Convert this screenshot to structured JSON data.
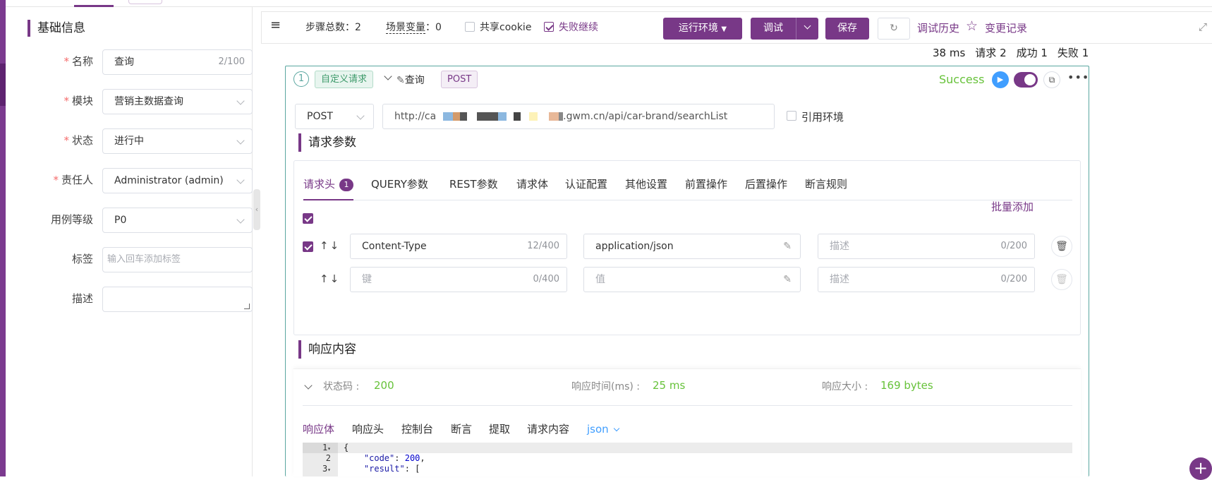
{
  "left_panel": {
    "title": "基础信息",
    "fields": {
      "name": {
        "label": "名称",
        "value": "查询",
        "count": "2/100",
        "required": "*"
      },
      "module": {
        "label": "模块",
        "value": "营销主数据查询",
        "required": "*"
      },
      "status": {
        "label": "状态",
        "value": "进行中",
        "required": "*"
      },
      "owner": {
        "label": "责任人",
        "value": "Administrator (admin)",
        "required": "*"
      },
      "level": {
        "label": "用例等级",
        "value": "P0"
      },
      "tags": {
        "label": "标签",
        "placeholder": "输入回车添加标签"
      },
      "desc": {
        "label": "描述"
      }
    }
  },
  "toolbar": {
    "menu_icon": "≡",
    "step_total_label": "步骤总数：2",
    "scenario_var_label": "场景变量",
    "scenario_var_value": "：0",
    "share_cookie": "共享cookie",
    "fail_continue": "失败继续",
    "run_env": "运行环境",
    "debug": "调试",
    "save": "保存",
    "debug_history": "调试历史",
    "change_log": "变更记录"
  },
  "stats": {
    "time": "38 ms",
    "requests": "请求 2",
    "success": "成功 1",
    "fail": "失败 1"
  },
  "step": {
    "number": "1",
    "type_tag": "自定义请求",
    "name": "查询",
    "method_tag": "POST",
    "result": "Success",
    "method": "POST",
    "url_prefix": "http://ca",
    "url_suffix": ".gwm.cn/api/car-brand/searchList",
    "ref_env": "引用环境"
  },
  "request_params": {
    "title": "请求参数",
    "tabs": [
      "请求头",
      "QUERY参数",
      "REST参数",
      "请求体",
      "认证配置",
      "其他设置",
      "前置操作",
      "后置操作",
      "断言规则"
    ],
    "header_badge": "1",
    "batch_add": "批量添加",
    "rows": [
      {
        "key": "Content-Type",
        "key_count": "12/400",
        "value": "application/json",
        "desc_placeholder": "描述",
        "desc_count": "0/200"
      },
      {
        "key_placeholder": "键",
        "key_count": "0/400",
        "value_placeholder": "值",
        "desc_placeholder": "描述",
        "desc_count": "0/200"
      }
    ]
  },
  "response": {
    "title": "响应内容",
    "status_label": "状态码 :",
    "status_value": "200",
    "time_label": "响应时间(ms) :",
    "time_value": "25 ms",
    "size_label": "响应大小 :",
    "size_value": "169 bytes",
    "tabs": [
      "响应体",
      "响应头",
      "控制台",
      "断言",
      "提取",
      "请求内容"
    ],
    "format": "json",
    "code_lines": [
      {
        "ln": "1",
        "text": "{"
      },
      {
        "ln": "2",
        "key": "\"code\"",
        "val": "200"
      },
      {
        "ln": "3",
        "key": "\"result\"",
        "tail": ": ["
      }
    ]
  },
  "colors": {
    "brand": "#783887",
    "success": "#67c23a",
    "teal": "#5aa6a0"
  }
}
